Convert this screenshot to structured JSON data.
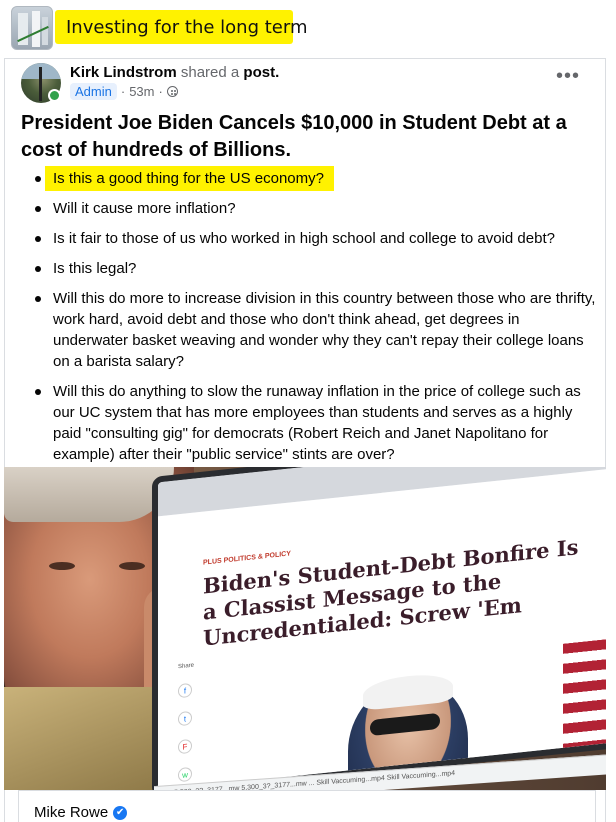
{
  "group": {
    "title": "Investing for the long term"
  },
  "post": {
    "author": "Kirk Lindstrom",
    "shared_text": "shared a",
    "post_word": "post.",
    "role_badge": "Admin",
    "time": "53m",
    "more": "•••",
    "title": "President Joe Biden Cancels $10,000 in Student Debt at a cost of hundreds of Billions.",
    "bullets": [
      "Is this a good thing for the US economy?",
      "Will it cause more inflation?",
      "Is it fair to those of us who worked in high school and college to avoid debt?",
      "Is this legal?",
      "Will this do more to increase division in this country between those who are thrifty, work hard, avoid debt and those who don't think ahead, get degrees in underwater basket weaving and wonder why they can't repay their college loans on a barista salary?",
      "Will this do anything to slow the runaway inflation in the price of college such as our UC system that has more employees than students and serves as a highly paid \"consulting gig\" for democrats (Robert Reich and Janet Napolitano for example) after their \"public service\" stints are over?"
    ]
  },
  "photo": {
    "screen_tag": "PLUS  POLITICS & POLICY",
    "headline": "Biden's Student-Debt Bonfire Is a Classist Message to the Uncredentialed: Screw 'Em",
    "share_label": "Share",
    "taskbar_text": "5,500_3?_3177...mw    5,300_3?_3177...mw    ...    Skill Vaccuming...mp4    Skill Vaccuming...mp4"
  },
  "shared_post": {
    "author": "Mike Rowe",
    "verified_icon": "✔"
  },
  "colors": {
    "highlight": "#fff200",
    "badge_text": "#1b74e4",
    "online": "#31a24c"
  }
}
